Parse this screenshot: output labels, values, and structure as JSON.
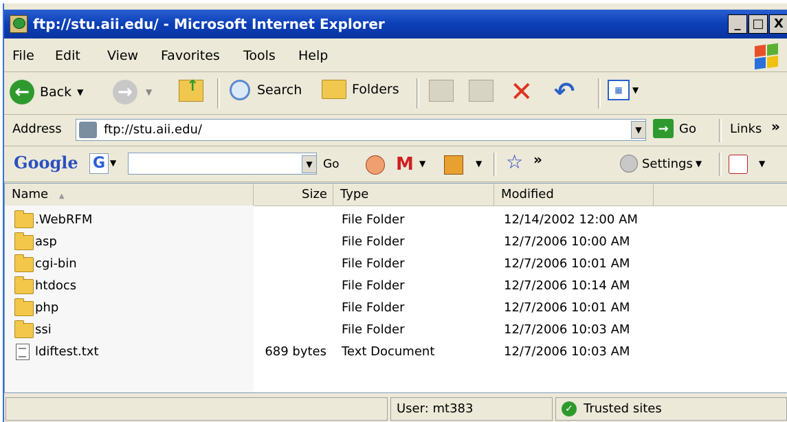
{
  "window": {
    "title": "ftp://stu.aii.edu/ - Microsoft Internet Explorer",
    "buttons": {
      "minimize": "_",
      "maximize": "□",
      "close": "X"
    }
  },
  "menu": {
    "file": "File",
    "edit": "Edit",
    "view": "View",
    "favorites": "Favorites",
    "tools": "Tools",
    "help": "Help"
  },
  "toolbar": {
    "back": "Back",
    "search": "Search",
    "folders": "Folders"
  },
  "address": {
    "label": "Address",
    "value": "ftp://stu.aii.edu/",
    "go": "Go",
    "links": "Links",
    "links_more": "»"
  },
  "google": {
    "brand": "Google",
    "g_button": "G",
    "go": "Go",
    "more": "»",
    "settings": "Settings"
  },
  "list": {
    "columns": {
      "name": "Name",
      "size": "Size",
      "type": "Type",
      "modified": "Modified"
    },
    "rows": [
      {
        "name": ".WebRFM",
        "size": "",
        "type": "File Folder",
        "modified": "12/14/2002 12:00 AM",
        "icon": "folder-icon"
      },
      {
        "name": "asp",
        "size": "",
        "type": "File Folder",
        "modified": "12/7/2006 10:00 AM",
        "icon": "folder-icon"
      },
      {
        "name": "cgi-bin",
        "size": "",
        "type": "File Folder",
        "modified": "12/7/2006 10:01 AM",
        "icon": "folder-icon"
      },
      {
        "name": "htdocs",
        "size": "",
        "type": "File Folder",
        "modified": "12/7/2006 10:14 AM",
        "icon": "folder-icon"
      },
      {
        "name": "php",
        "size": "",
        "type": "File Folder",
        "modified": "12/7/2006 10:01 AM",
        "icon": "folder-icon"
      },
      {
        "name": "ssi",
        "size": "",
        "type": "File Folder",
        "modified": "12/7/2006 10:03 AM",
        "icon": "folder-icon"
      },
      {
        "name": "ldiftest.txt",
        "size": "689 bytes",
        "type": "Text Document",
        "modified": "12/7/2006 10:03 AM",
        "icon": "text-document-icon"
      }
    ]
  },
  "status": {
    "user": "User: mt383",
    "zone": "Trusted sites"
  },
  "colors": {
    "titlebar": "#0b3fb8",
    "chrome": "#ece9d8",
    "folder": "#f3c84a",
    "stop_red": "#e03020",
    "back_green": "#2e9a2e"
  }
}
